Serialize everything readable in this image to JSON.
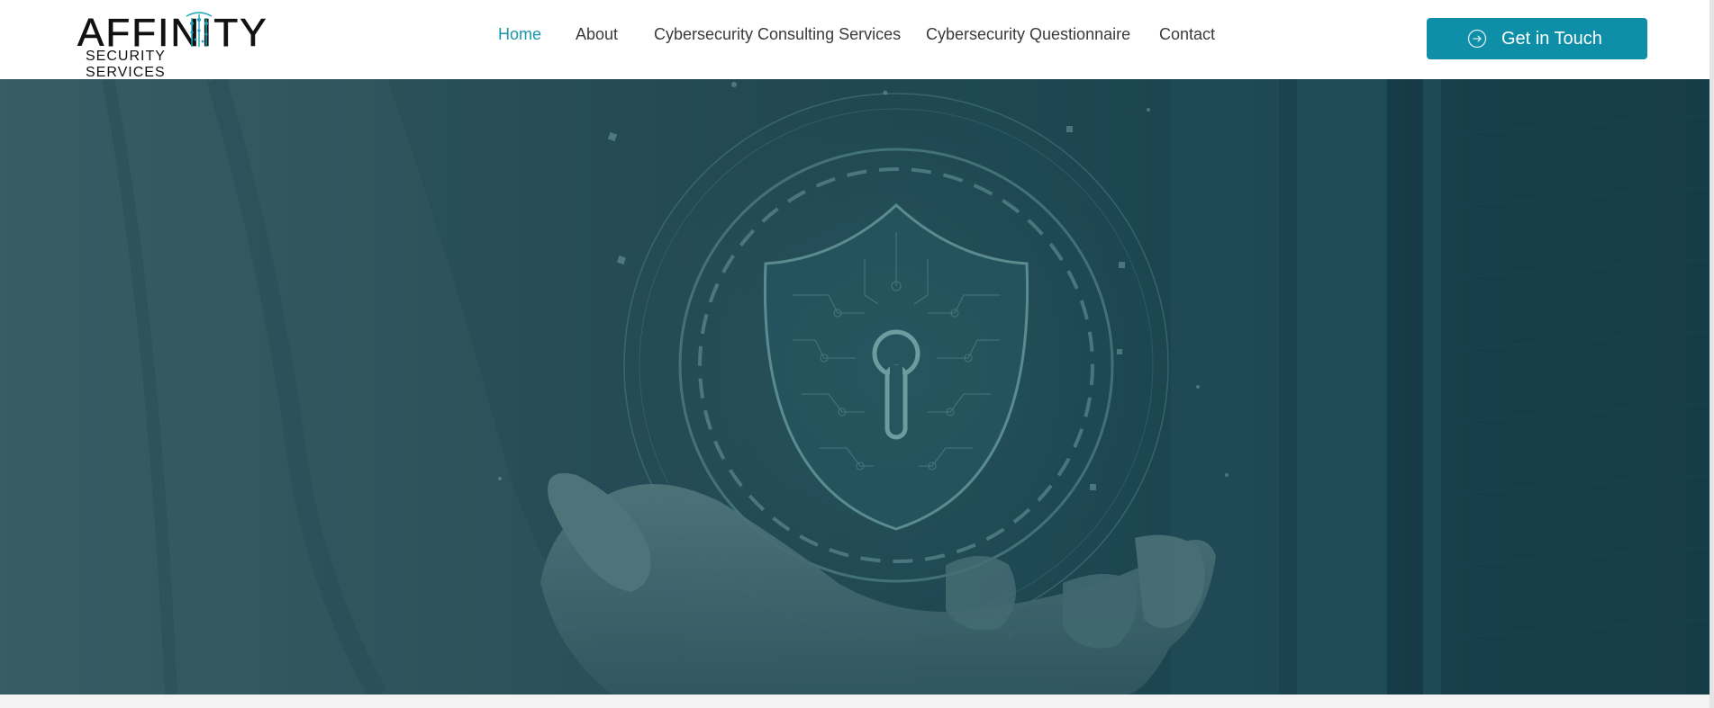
{
  "brand": {
    "logo_main": "AFFINITY",
    "logo_sub": "SECURITY SERVICES"
  },
  "nav": {
    "items": [
      {
        "label": "Home",
        "active": true
      },
      {
        "label": "About",
        "active": false
      },
      {
        "label": "Cybersecurity Consulting Services",
        "active": false
      },
      {
        "label": "Cybersecurity Questionnaire",
        "active": false
      },
      {
        "label": "Contact",
        "active": false
      }
    ]
  },
  "cta": {
    "label": "Get in Touch",
    "icon": "arrow-circle-right-icon"
  },
  "hero": {
    "image": "hand-holding-shield-keyhole",
    "icon": "shield-keyhole-icon"
  },
  "colors": {
    "accent": "#0f8ea8",
    "nav_active": "#1a93ad",
    "nav_text": "#3a3a3a",
    "hero_tint": "#244a55"
  }
}
